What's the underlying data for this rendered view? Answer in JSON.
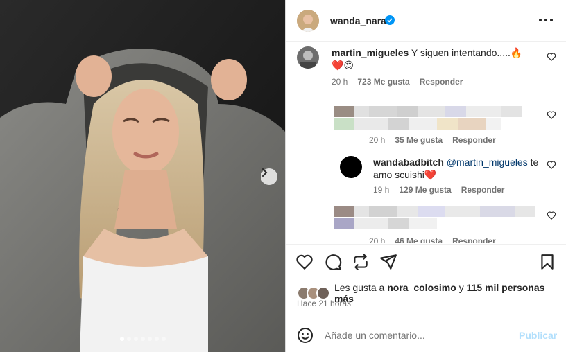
{
  "post": {
    "username": "wanda_nara",
    "verified": true,
    "carousel_dots": 7,
    "carousel_active": 0
  },
  "comments": [
    {
      "username": "martin_migueles",
      "text": "Y siguen intentando.....🔥❤️😍",
      "time": "20 h",
      "likes": "723 Me gusta",
      "reply": "Responder"
    },
    {
      "username": "",
      "text": "",
      "time": "20 h",
      "likes": "35 Me gusta",
      "reply": "Responder",
      "blurred": true
    },
    {
      "username": "wandabadbitch",
      "mention": "@martin_migueles",
      "text": " te amo scuishi❤️",
      "time": "19 h",
      "likes": "129 Me gusta",
      "reply": "Responder"
    },
    {
      "username": "",
      "text": "",
      "time": "20 h",
      "likes": "46 Me gusta",
      "reply": "Responder",
      "blurred": true
    }
  ],
  "likes_summary": {
    "prefix": "Les gusta a ",
    "user": "nora_colosimo",
    "middle": " y ",
    "count": "115 mil personas más"
  },
  "posted_ago": "Hace 21 horas",
  "add_comment": {
    "placeholder": "Añade un comentario...",
    "publish_label": "Publicar"
  },
  "icons": [
    "heart-icon",
    "comment-icon",
    "repost-icon",
    "share-icon",
    "bookmark-icon",
    "emoji-icon",
    "more-icon",
    "verified-icon",
    "chevron-right-icon"
  ],
  "colors": {
    "accent": "#0095f6",
    "publish_disabled": "#b2dffc",
    "muted": "#737373",
    "heart_red": "#ed4956"
  }
}
